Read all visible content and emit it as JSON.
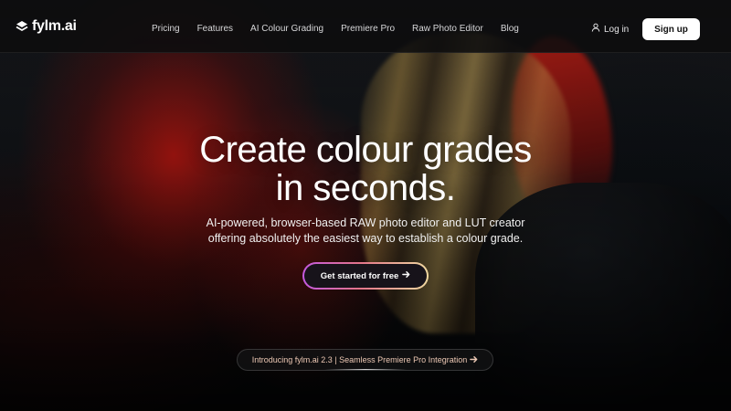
{
  "brand": {
    "name": "fylm.ai"
  },
  "nav": {
    "links": [
      {
        "label": "Pricing"
      },
      {
        "label": "Features"
      },
      {
        "label": "AI Colour Grading"
      },
      {
        "label": "Premiere Pro"
      },
      {
        "label": "Raw Photo Editor"
      },
      {
        "label": "Blog"
      }
    ],
    "login_label": "Log in",
    "signup_label": "Sign up"
  },
  "hero": {
    "title_line1": "Create colour grades",
    "title_line2": "in seconds.",
    "subtitle_line1": "AI-powered, browser-based RAW photo editor and LUT creator",
    "subtitle_line2": "offering absolutely the easiest way to establish a colour grade.",
    "cta_label": "Get started for free",
    "announcement": "Introducing fylm.ai 2.3 | Seamless Premiere Pro Integration"
  },
  "icons": {
    "logo": "logo-mark-icon",
    "login": "user-icon",
    "cta_arrow": "arrow-right-icon",
    "announce_arrow": "arrow-right-icon"
  },
  "colors": {
    "accent_gradient_start": "#c45ae0",
    "accent_gradient_mid": "#e3748a",
    "accent_gradient_end": "#f0d9a0",
    "signup_bg": "#ffffff",
    "announcement_text": "#ecc8b4"
  }
}
